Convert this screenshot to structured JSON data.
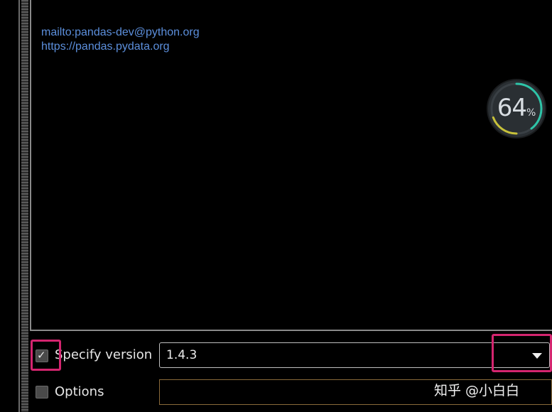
{
  "description": {
    "links": [
      "mailto:pandas-dev@python.org",
      "https://pandas.pydata.org"
    ]
  },
  "gauge": {
    "value": "64",
    "unit": "%",
    "progress_fraction": 0.64,
    "ring_color": "#2ec4a8",
    "accent_color": "#c8c23a"
  },
  "options": {
    "specify_version": {
      "label": "Specify version",
      "checked": true,
      "check_glyph": "✓",
      "selected_version": "1.4.3"
    },
    "options_field": {
      "label": "Options",
      "checked": false,
      "value": ""
    }
  },
  "watermark": {
    "text": "知乎 @小白白"
  },
  "colors": {
    "link": "#5c8fdc",
    "highlight": "#d4256f",
    "background": "#000000"
  }
}
